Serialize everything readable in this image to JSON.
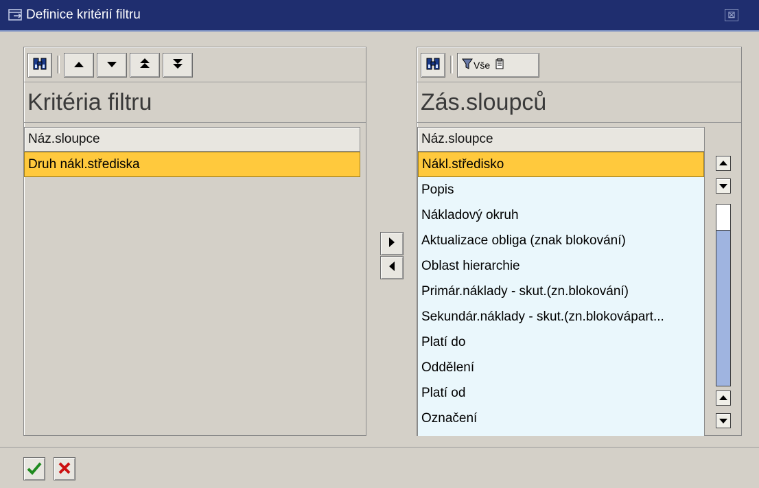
{
  "window": {
    "title": "Definice kritérií filtru",
    "close_label": "⊠"
  },
  "left_panel": {
    "heading": "Kritéria filtru",
    "column_header": "Náz.sloupce",
    "rows": [
      "Druh nákl.střediska"
    ],
    "selected_index": 0,
    "toolbar_icons": [
      "find-icon",
      "move-up-icon",
      "move-down-icon",
      "move-top-icon",
      "move-bottom-icon"
    ]
  },
  "right_panel": {
    "heading": "Zás.sloupců",
    "column_header": "Náz.sloupce",
    "filter_button_label": "Vše",
    "rows": [
      "Nákl.středisko",
      "Popis",
      "Nákladový okruh",
      "Aktualizace obliga (znak blokování)",
      "Oblast hierarchie",
      "Primár.náklady - skut.(zn.blokování)",
      "Sekundár.náklady - skut.(zn.blokovápart...",
      "Platí do",
      "Oddělení",
      "Platí od",
      "Označení"
    ],
    "selected_index": 0,
    "scroll_position": 0.0
  },
  "transfer_buttons": [
    "move-right-icon",
    "move-left-icon"
  ],
  "footer": {
    "buttons": [
      "confirm-icon",
      "cancel-icon"
    ]
  },
  "colors": {
    "titlebar": "#1f2e6f",
    "selection": "#ffc93d",
    "list_background": "#eaf7fc",
    "window_background": "#d4d0c8"
  }
}
